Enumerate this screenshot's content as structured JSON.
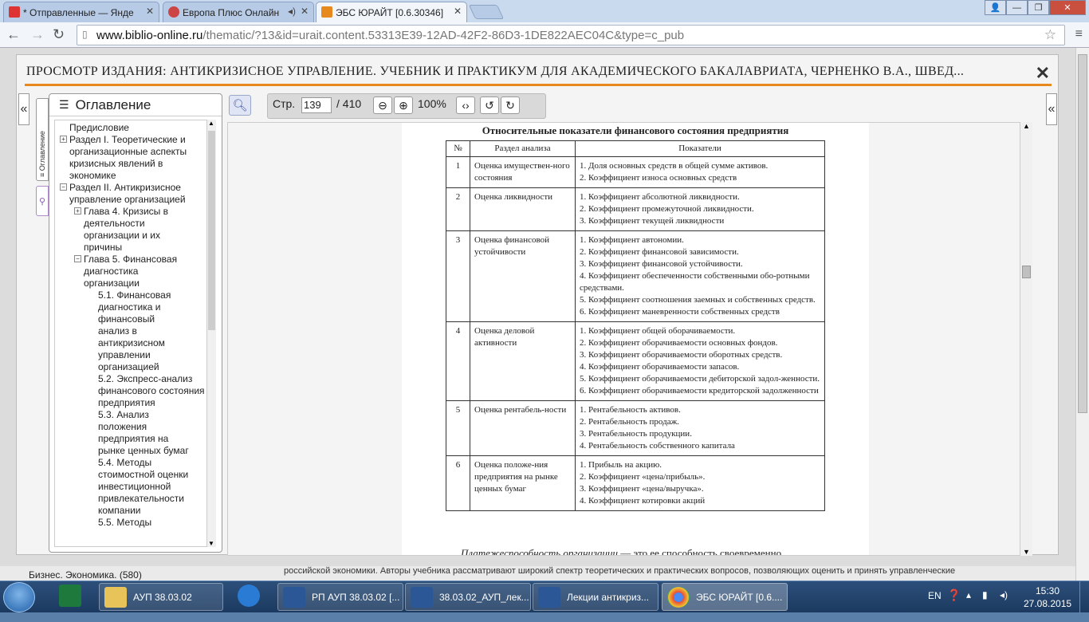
{
  "browser": {
    "tabs": [
      {
        "label": "* Отправленные — Янде"
      },
      {
        "label": "Европа Плюс Онлайн"
      },
      {
        "label": "ЭБС ЮРАЙТ [0.6.30346]"
      }
    ],
    "url_host": "www.biblio-online.ru",
    "url_path": "/thematic/?13&id=urait.content.53313E39-12AD-42F2-86D3-1DE822AEC04C&type=c_pub",
    "accent": "#e8891e"
  },
  "modal": {
    "title": "ПРОСМОТР ИЗДАНИЯ: АНТИКРИЗИСНОЕ УПРАВЛЕНИЕ. УЧЕБНИК И ПРАКТИКУМ ДЛЯ АКАДЕМИЧЕСКОГО БАКАЛАВРИАТА, ЧЕРНЕНКО В.А., ШВЕД...",
    "close": "✕",
    "vtab_label": "≡ Оглавление"
  },
  "toc": {
    "heading": "Оглавление",
    "items": [
      "Предисловие",
      "Раздел I. Теоретические и организационные аспекты кризисных явлений в экономике",
      "Раздел II. Антикризисное управление организацией",
      "Глава 4. Кризисы в деятельности организации и их причины",
      "Глава 5. Финансовая диагностика организации",
      "5.1. Финансовая диагностика и финансовый анализ в антикризисном управлении организацией",
      "5.2. Экспресс-анализ финансового состояния предприятия",
      "5.3. Анализ положения предприятия на рынке ценных бумаг",
      "5.4. Методы стоимостной оценки инвестиционной привлекательности компании",
      "5.5. Методы"
    ]
  },
  "toolbar": {
    "page_label": "Стр.",
    "page_value": "139",
    "page_total": "/ 410",
    "zoom": "100%"
  },
  "document": {
    "title": "Относительные показатели финансового состояния предприятия",
    "headers": [
      "№",
      "Раздел анализа",
      "Показатели"
    ],
    "rows": [
      {
        "n": "1",
        "sec": "Оценка имуществен-ного состояния",
        "ind": "1. Доля основных средств в общей сумме активов.\n2. Коэффициент износа основных средств"
      },
      {
        "n": "2",
        "sec": "Оценка ликвидности",
        "ind": "1. Коэффициент абсолютной ликвидности.\n2. Коэффициент промежуточной ликвидности.\n3. Коэффициент текущей ликвидности"
      },
      {
        "n": "3",
        "sec": "Оценка финансовой устойчивости",
        "ind": "1. Коэффициент автономии.\n2. Коэффициент финансовой зависимости.\n3. Коэффициент финансовой устойчивости.\n4. Коэффициент обеспеченности собственными обо-ротными средствами.\n5. Коэффициент соотношения заемных и собственных средств.\n6. Коэффициент маневренности собственных средств"
      },
      {
        "n": "4",
        "sec": "Оценка деловой активности",
        "ind": "1. Коэффициент общей оборачиваемости.\n2. Коэффициент оборачиваемости основных фондов.\n3. Коэффициент оборачиваемости оборотных средств.\n4. Коэффициент оборачиваемости запасов.\n5. Коэффициент оборачиваемости дебиторской задол-женности.\n6. Коэффициент оборачиваемости кредиторской задолженности"
      },
      {
        "n": "5",
        "sec": "Оценка рентабель-ности",
        "ind": "1. Рентабельность активов.\n2. Рентабельность продаж.\n3. Рентабельность продукции.\n4. Рентабельность собственного капитала"
      },
      {
        "n": "6",
        "sec": "Оценка положе-ния предприятия на рынке ценных бумаг",
        "ind": "1. Прибыль на акцию.\n2. Коэффициент «цена/прибыль».\n3. Коэффициент «цена/выручка».\n4. Коэффициент котировки акций"
      }
    ],
    "bottom_text_italic": "Платежеспособность организации",
    "bottom_text_rest": " — это ее способность своевременно"
  },
  "background": {
    "left_footer": "Бизнес. Экономика. (580)",
    "right_footer": "российской экономики. Авторы учебника рассматривают широкий спектр теоретических и практических вопросов, позволяющих оценить и принять управленческие"
  },
  "taskbar": {
    "tasks": [
      {
        "label": "АУП 38.03.02"
      },
      {
        "label": "РП АУП 38.03.02 [..."
      },
      {
        "label": "38.03.02_АУП_лек..."
      },
      {
        "label": "Лекции антикриз..."
      },
      {
        "label": "ЭБС ЮРАЙТ [0.6...."
      }
    ],
    "lang": "EN",
    "time": "15:30",
    "date": "27.08.2015"
  }
}
